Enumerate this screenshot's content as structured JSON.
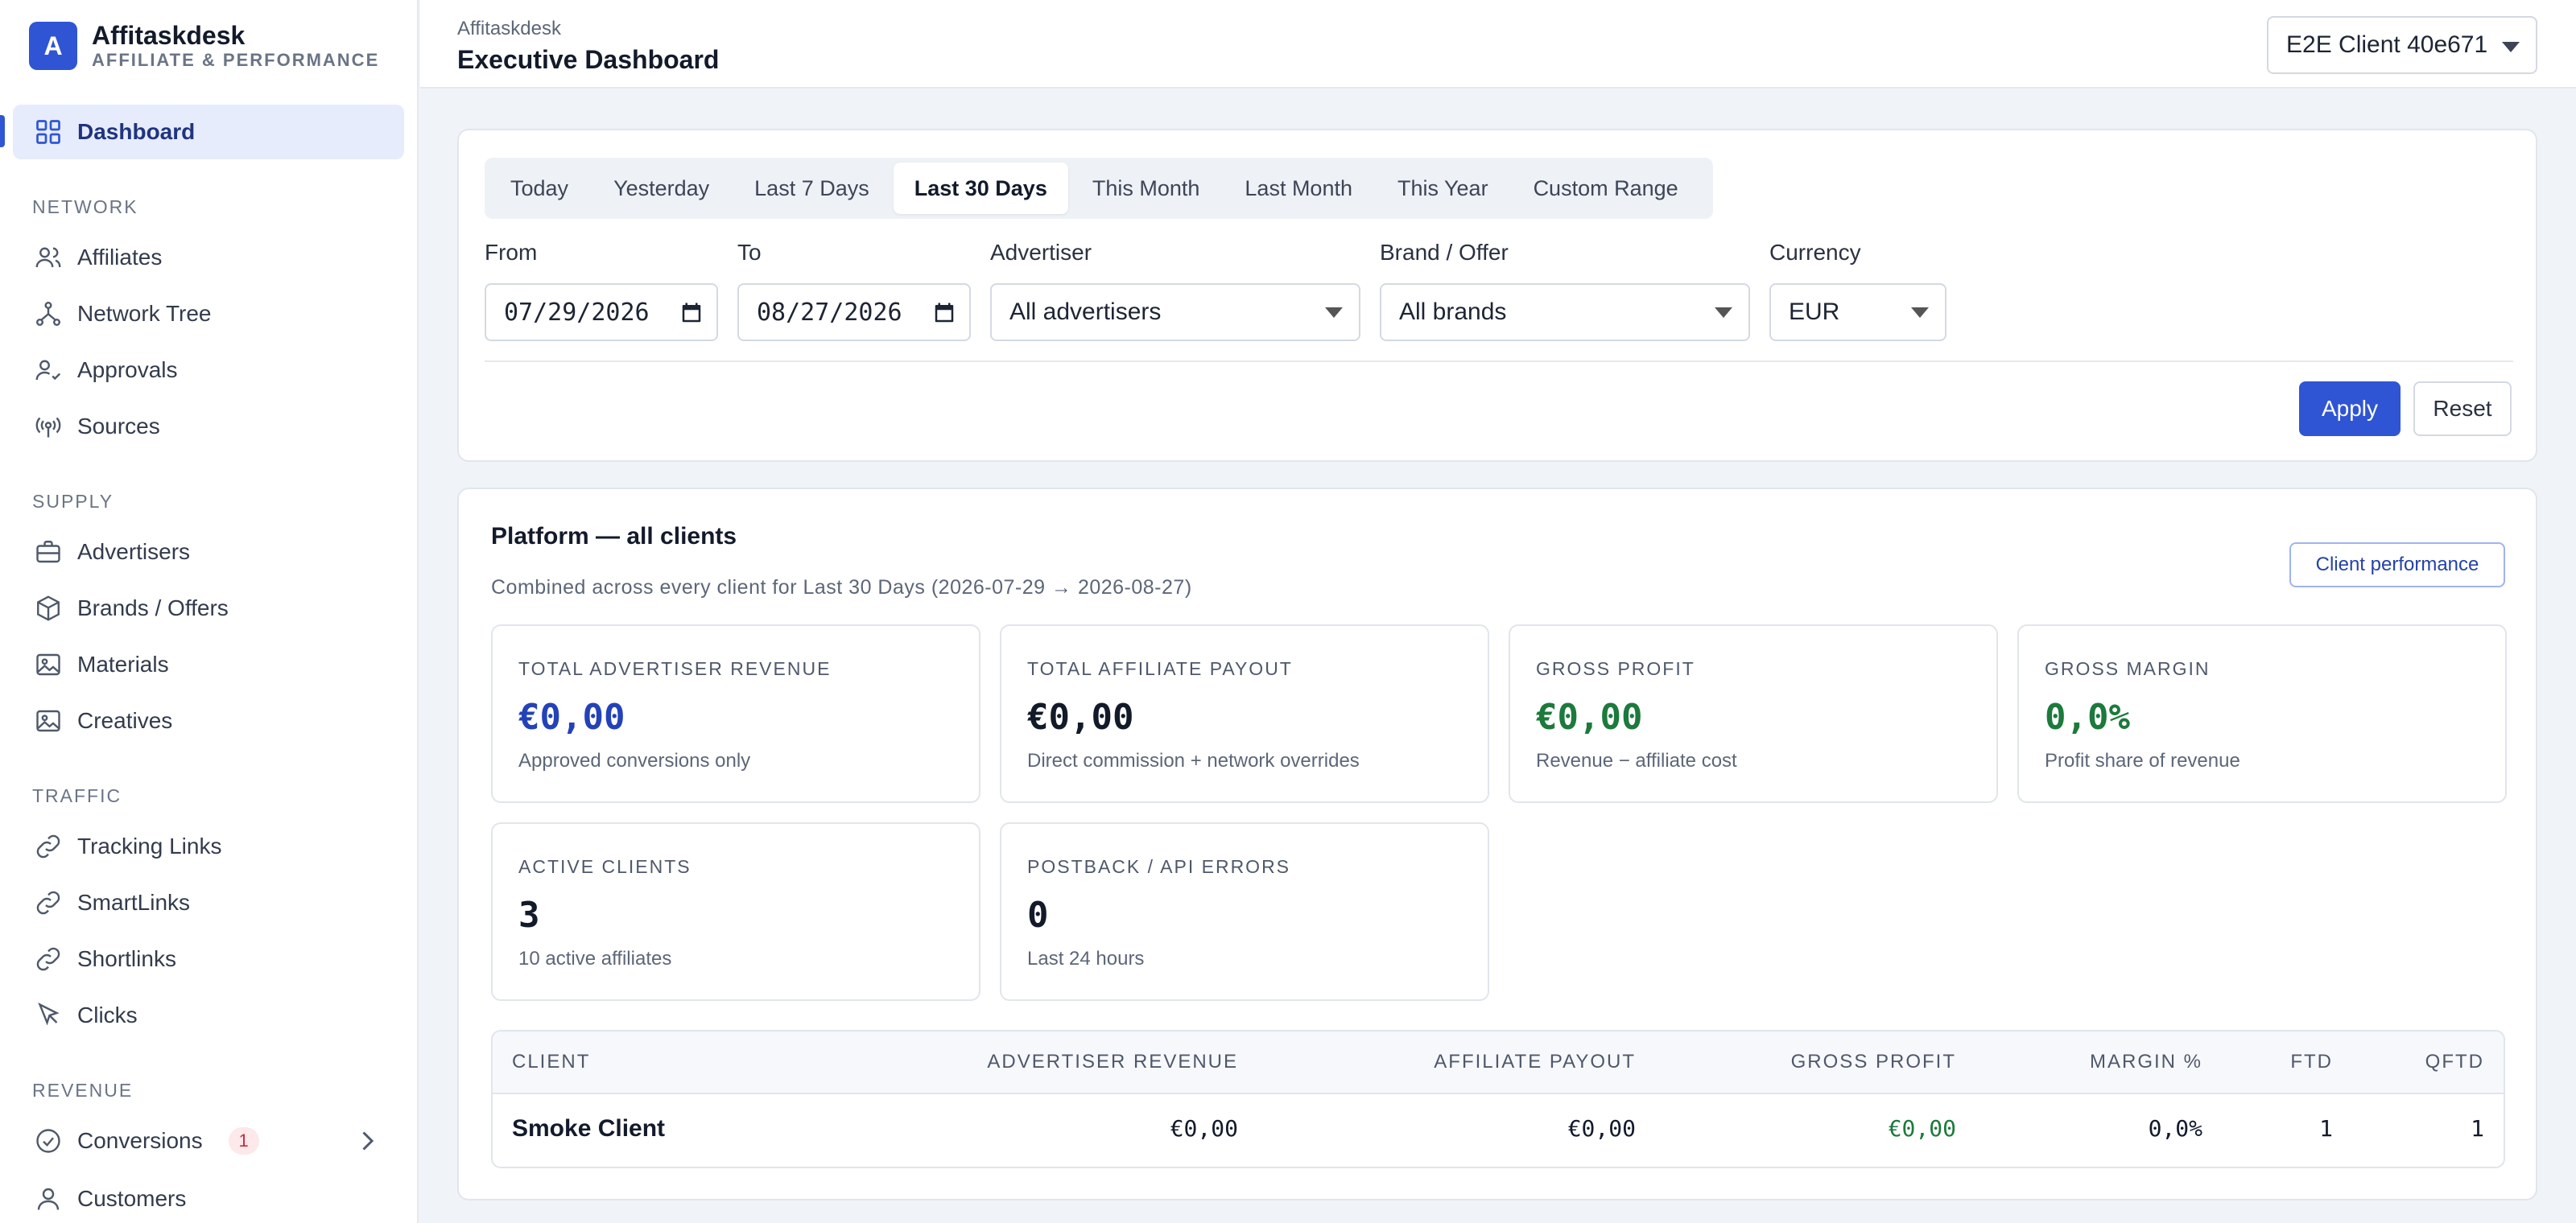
{
  "brand": {
    "logo_letter": "A",
    "name": "Affitaskdesk",
    "tagline": "AFFILIATE & PERFORMANCE"
  },
  "sidebar": {
    "dashboard": "Dashboard",
    "sections": {
      "network": "NETWORK",
      "supply": "SUPPLY",
      "traffic": "TRAFFIC",
      "revenue": "REVENUE"
    },
    "network_items": [
      "Affiliates",
      "Network Tree",
      "Approvals",
      "Sources"
    ],
    "supply_items": [
      "Advertisers",
      "Brands / Offers",
      "Materials",
      "Creatives"
    ],
    "traffic_items": [
      "Tracking Links",
      "SmartLinks",
      "Shortlinks",
      "Clicks"
    ],
    "revenue_items": [
      "Conversions",
      "Customers"
    ],
    "conversions_badge": "1"
  },
  "header": {
    "breadcrumb": "Affitaskdesk",
    "title": "Executive Dashboard",
    "client_selector": "E2E Client 40e671"
  },
  "filters": {
    "ranges": [
      "Today",
      "Yesterday",
      "Last 7 Days",
      "Last 30 Days",
      "This Month",
      "Last Month",
      "This Year",
      "Custom Range"
    ],
    "active_range": "Last 30 Days",
    "from_label": "From",
    "from_value": "07/29/2026",
    "to_label": "To",
    "to_value": "08/27/2026",
    "advertiser_label": "Advertiser",
    "advertiser_value": "All advertisers",
    "brand_label": "Brand / Offer",
    "brand_value": "All brands",
    "currency_label": "Currency",
    "currency_value": "EUR",
    "apply": "Apply",
    "reset": "Reset"
  },
  "platform": {
    "title": "Platform — all clients",
    "subtitle": "Combined across every client for Last 30 Days (2026-07-29 → 2026-08-27)",
    "client_performance_button": "Client performance",
    "kpis": [
      {
        "label": "TOTAL ADVERTISER REVENUE",
        "value": "€0,00",
        "note": "Approved conversions only"
      },
      {
        "label": "TOTAL AFFILIATE PAYOUT",
        "value": "€0,00",
        "note": "Direct commission + network overrides"
      },
      {
        "label": "GROSS PROFIT",
        "value": "€0,00",
        "note": "Revenue − affiliate cost"
      },
      {
        "label": "GROSS MARGIN",
        "value": "0,0%",
        "note": "Profit share of revenue"
      },
      {
        "label": "ACTIVE CLIENTS",
        "value": "3",
        "note": "10 active affiliates"
      },
      {
        "label": "POSTBACK / API ERRORS",
        "value": "0",
        "note": "Last 24 hours"
      }
    ],
    "table": {
      "columns": [
        "CLIENT",
        "ADVERTISER REVENUE",
        "AFFILIATE PAYOUT",
        "GROSS PROFIT",
        "MARGIN %",
        "FTD",
        "QFTD"
      ],
      "rows": [
        [
          "Smoke Client",
          "€0,00",
          "€0,00",
          "€0,00",
          "0,0%",
          "1",
          "1"
        ]
      ]
    }
  },
  "colors": {
    "accent": "#2f55d4",
    "positive": "#1c7a3c",
    "revenue_blue": "#2442b8"
  }
}
